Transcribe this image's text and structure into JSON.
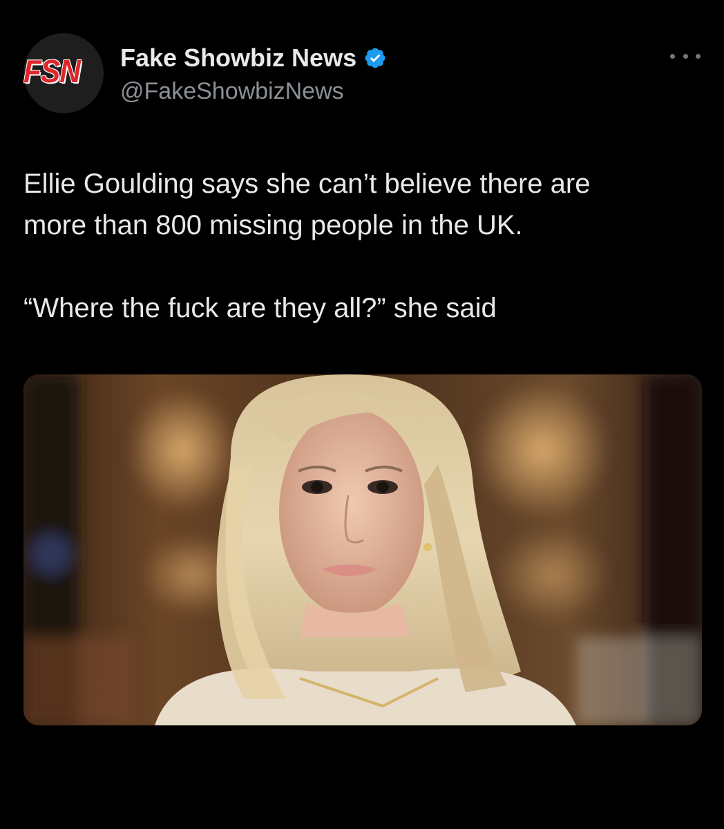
{
  "author": {
    "avatar_logo": "FSN",
    "display_name": "Fake Showbiz News",
    "handle": "@FakeShowbizNews",
    "verified": true,
    "verified_color": "#1d9bf0",
    "logo_color": "#e0262b"
  },
  "menu": {
    "icon": "more-horizontal-icon"
  },
  "post": {
    "line1": "Ellie Goulding says she can’t believe there are",
    "line2": "more than 800 missing people in the UK.",
    "quote": "“Where the fuck are they all?” she said"
  },
  "media": {
    "type": "photo"
  },
  "colors": {
    "background": "#000000",
    "text_primary": "#e7e9ea",
    "text_secondary": "#8b9096"
  }
}
